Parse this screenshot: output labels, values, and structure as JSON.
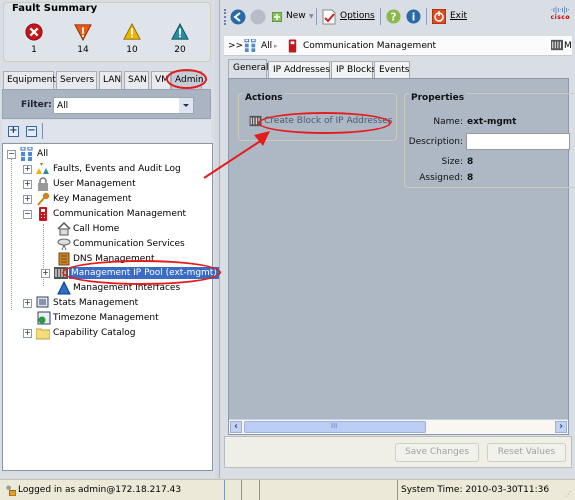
{
  "fault_summary": {
    "title": "Fault Summary",
    "items": [
      {
        "severity": "critical",
        "icon": "critical-fault-icon",
        "count": "1",
        "color": "#c8141c"
      },
      {
        "severity": "major",
        "icon": "major-fault-icon",
        "count": "14",
        "color": "#e85a12"
      },
      {
        "severity": "minor",
        "icon": "minor-fault-icon",
        "count": "10",
        "color": "#f0b400"
      },
      {
        "severity": "warning",
        "icon": "warning-fault-icon",
        "count": "20",
        "color": "#2a8ca0"
      }
    ]
  },
  "nav_tabs": [
    {
      "label": "Equipment",
      "active": false
    },
    {
      "label": "Servers",
      "active": false
    },
    {
      "label": "LAN",
      "active": false
    },
    {
      "label": "SAN",
      "active": false
    },
    {
      "label": "VM",
      "active": false
    },
    {
      "label": "Admin",
      "active": true
    }
  ],
  "filter": {
    "label": "Filter:",
    "value": "All"
  },
  "tree_toolbar": {
    "expand_icon": "expand-all-icon",
    "collapse_icon": "collapse-all-icon"
  },
  "tree": {
    "root": {
      "label": "All",
      "icon": "hierarchy-icon"
    },
    "items": [
      {
        "label": "Faults, Events and Audit Log",
        "icon": "faults-icon"
      },
      {
        "label": "User Management",
        "icon": "lock-icon"
      },
      {
        "label": "Key Management",
        "icon": "key-icon"
      },
      {
        "label": "Communication Management",
        "icon": "phone-icon"
      },
      {
        "label": "Call Home",
        "icon": "house-icon"
      },
      {
        "label": "Communication Services",
        "icon": "satellite-icon"
      },
      {
        "label": "DNS Management",
        "icon": "dns-icon"
      },
      {
        "label": "Management IP Pool (ext-mgmt)",
        "icon": "ip-pool-icon",
        "selected": true
      },
      {
        "label": "Management Interfaces",
        "icon": "interfaces-icon"
      },
      {
        "label": "Stats Management",
        "icon": "stats-icon"
      },
      {
        "label": "Timezone Management",
        "icon": "clock-icon"
      },
      {
        "label": "Capability Catalog",
        "icon": "folder-icon"
      }
    ]
  },
  "toolbar": {
    "back_icon": "back-icon",
    "forward_icon": "forward-icon",
    "new_label": "New",
    "options_label": "Options",
    "help_icon": "help-icon",
    "info_icon": "info-icon",
    "exit_label": "Exit",
    "brand": "cisco"
  },
  "breadcrumb": {
    "prefix": ">>",
    "items": [
      "All",
      "Communication Management"
    ],
    "overflow": "Mar"
  },
  "content_tabs": [
    {
      "label": "General",
      "active": true
    },
    {
      "label": "IP Addresses",
      "active": false
    },
    {
      "label": "IP Blocks",
      "active": false
    },
    {
      "label": "Events",
      "active": false
    }
  ],
  "actions": {
    "title": "Actions",
    "items": [
      {
        "label": "Create Block of IP Addresses",
        "icon": "ip-block-icon"
      }
    ]
  },
  "properties": {
    "title": "Properties",
    "name_label": "Name:",
    "name_value": "ext-mgmt",
    "description_label": "Description:",
    "description_value": "",
    "size_label": "Size:",
    "size_value": "8",
    "assigned_label": "Assigned:",
    "assigned_value": "8"
  },
  "buttons": {
    "save": "Save Changes",
    "reset": "Reset Values"
  },
  "status_bar": {
    "login": "Logged in as admin@172.18.217.43",
    "system_time": "System Time: 2010-03-30T11:36"
  },
  "annotation_color": "#e41c1c"
}
